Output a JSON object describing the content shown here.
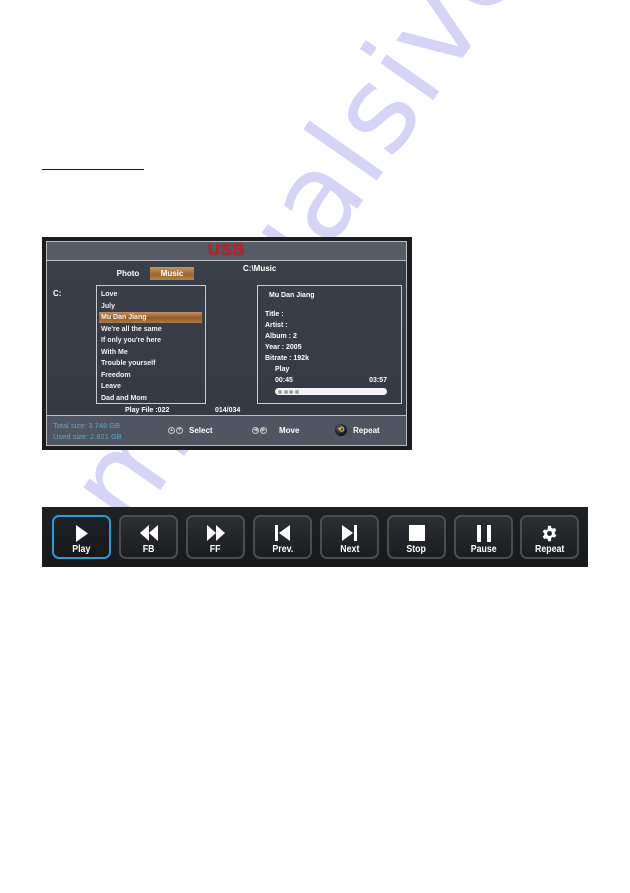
{
  "watermark": "manualsive.com",
  "usb_screen": {
    "title": "USB",
    "tabs": [
      {
        "label": "Photo",
        "active": false
      },
      {
        "label": "Music",
        "active": true
      }
    ],
    "path": "C:\\Music",
    "drive": "C:",
    "file_list": [
      {
        "name": "Love",
        "selected": false
      },
      {
        "name": "July",
        "selected": false
      },
      {
        "name": "Mu Dan Jiang",
        "selected": true
      },
      {
        "name": "We're all the same",
        "selected": false
      },
      {
        "name": "If only you're here",
        "selected": false
      },
      {
        "name": "With Me",
        "selected": false
      },
      {
        "name": "Trouble yourself",
        "selected": false
      },
      {
        "name": "Freedom",
        "selected": false
      },
      {
        "name": "Leave",
        "selected": false
      },
      {
        "name": "Dad and Mom",
        "selected": false
      }
    ],
    "info": {
      "song_name": "Mu Dan Jiang",
      "title": "Title :",
      "artist": "Artist :",
      "album": "Album : 2",
      "year": "Year : 2005",
      "bitrate": "Bitrate : 192k",
      "status": "Play",
      "elapsed": "00:45",
      "total": "03:57",
      "progress_fraction": 0.19
    },
    "play_file": "Play File  :022",
    "file_count": "014/034",
    "footer": {
      "total_size": "Total size: 3.748 GB",
      "used_size": "Used size: 2.821 GB",
      "hints": [
        {
          "icon": "up-down-arrows-icon",
          "label": "Select"
        },
        {
          "icon": "left-right-arrows-icon",
          "label": "Move"
        },
        {
          "icon": "repeat-icon",
          "label": "Repeat"
        }
      ]
    },
    "colors": {
      "title_red": "#c2222a",
      "highlight_gold": "#9b6632",
      "size_text_blue": "#5aa7c6"
    }
  },
  "control_bar": {
    "buttons": [
      {
        "label": "Play",
        "icon": "play-icon",
        "active": true
      },
      {
        "label": "FB",
        "icon": "fast-backward-icon",
        "active": false
      },
      {
        "label": "FF",
        "icon": "fast-forward-icon",
        "active": false
      },
      {
        "label": "Prev.",
        "icon": "skip-previous-icon",
        "active": false
      },
      {
        "label": "Next",
        "icon": "skip-next-icon",
        "active": false
      },
      {
        "label": "Stop",
        "icon": "stop-icon",
        "active": false
      },
      {
        "label": "Pause",
        "icon": "pause-icon",
        "active": false
      },
      {
        "label": "Repeat",
        "icon": "gear-icon",
        "active": false
      }
    ],
    "active_color": "#2d9bd6"
  }
}
